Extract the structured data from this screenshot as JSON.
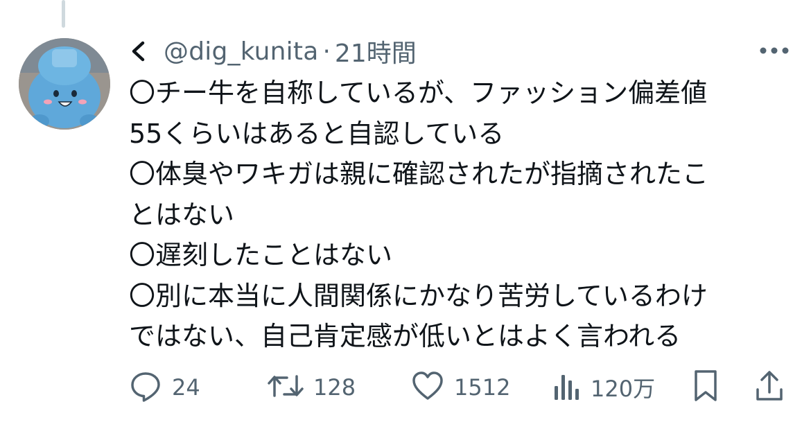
{
  "tweet": {
    "handle": "@dig_kunita",
    "separator": "·",
    "time": "21時間",
    "lines": [
      "〇チー牛を自称しているが、ファッション偏差値",
      "55くらいはあると自認している",
      "〇体臭やワキガは親に確認されたが指摘されたこ",
      "とはない",
      "〇遅刻したことはない",
      "〇別に本当に人間関係にかなり苦労しているわけ",
      "ではない、自己肯定感が低いとはよく言われる"
    ]
  },
  "actions": {
    "reply_count": "24",
    "retweet_count": "128",
    "like_count": "1512",
    "views_count": "120万"
  },
  "icons": {
    "back": "chevron-left-icon",
    "more": "more-horizontal-icon",
    "reply": "reply-icon",
    "retweet": "retweet-icon",
    "like": "heart-icon",
    "views": "views-icon",
    "bookmark": "bookmark-icon",
    "share": "share-icon"
  },
  "colors": {
    "text": "#0f1419",
    "secondary": "#536471",
    "thread_line": "#cfd9de"
  }
}
